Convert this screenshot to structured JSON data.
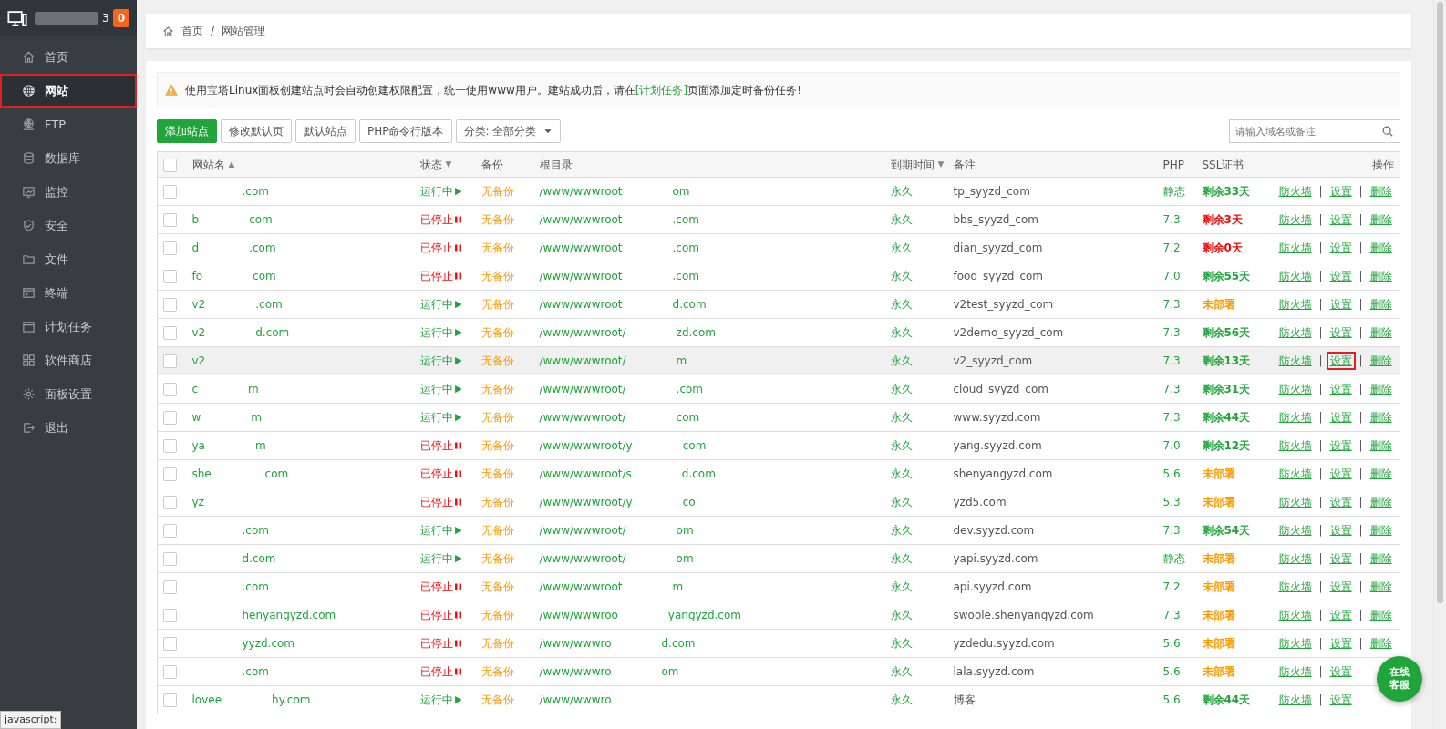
{
  "sidebar": {
    "title_end": "3",
    "badge": "0",
    "items": [
      {
        "label": "首页",
        "selected": false,
        "boxed": false
      },
      {
        "label": "网站",
        "selected": true,
        "boxed": true
      },
      {
        "label": "FTP",
        "selected": false,
        "boxed": false
      },
      {
        "label": "数据库",
        "selected": false,
        "boxed": false
      },
      {
        "label": "监控",
        "selected": false,
        "boxed": false
      },
      {
        "label": "安全",
        "selected": false,
        "boxed": false
      },
      {
        "label": "文件",
        "selected": false,
        "boxed": false
      },
      {
        "label": "终端",
        "selected": false,
        "boxed": false
      },
      {
        "label": "计划任务",
        "selected": false,
        "boxed": false
      },
      {
        "label": "软件商店",
        "selected": false,
        "boxed": false
      },
      {
        "label": "面板设置",
        "selected": false,
        "boxed": false
      },
      {
        "label": "退出",
        "selected": false,
        "boxed": false
      }
    ]
  },
  "breadcrumb": [
    "首页",
    "网站管理"
  ],
  "breadcrumb_separator": "/",
  "alert": {
    "before": "使用宝塔Linux面板创建站点时会自动创建权限配置，统一使用www用户。建站成功后，请在",
    "link": "[计划任务]",
    "after": "页面添加定时备份任务!"
  },
  "toolbar": {
    "primary": "添加站点",
    "buttons": [
      "修改默认页",
      "默认站点",
      "PHP命令行版本"
    ],
    "category": "分类: 全部分类",
    "search": {
      "placeholder": "请输入域名或备注"
    }
  },
  "table": {
    "header_checked": false,
    "action_separator": "|",
    "columns": [
      {
        "label": "网站名",
        "sort_icon": "▲"
      },
      {
        "label": "状态",
        "sort_icon": "▼"
      },
      {
        "label": "备份"
      },
      {
        "label": "根目录"
      },
      {
        "label": "到期时间",
        "sort_icon": "▼"
      },
      {
        "label": "备注"
      },
      {
        "label": "PHP"
      },
      {
        "label": "SSL证书"
      },
      {
        "label": "操作"
      }
    ],
    "rows": [
      {
        "checked": false,
        "highlighted": false,
        "name_start": "",
        "name_end": ".com",
        "running": true,
        "status_text": "运行中",
        "backup": "无备份",
        "path_start": "/www/wwwroot",
        "path_end": "om",
        "expiry": "永久",
        "remark": "tp_syyzd_com",
        "php": "静态",
        "ssl": "剩余33天",
        "color": "#20a53a",
        "actions": [
          "防火墙",
          "设置",
          "删除"
        ],
        "boxed_action": false
      },
      {
        "checked": false,
        "highlighted": false,
        "name_start": "b",
        "name_end": "com",
        "running": false,
        "status_text": "已停止",
        "backup": "无备份",
        "path_start": "/www/wwwroot",
        "path_end": ".com",
        "expiry": "永久",
        "remark": "bbs_syyzd_com",
        "php": "7.3",
        "ssl": "剩余3天",
        "color": "#ef0808",
        "actions": [
          "防火墙",
          "设置",
          "删除"
        ],
        "boxed_action": false
      },
      {
        "checked": false,
        "highlighted": false,
        "name_start": "d",
        "name_end": ".com",
        "running": false,
        "status_text": "已停止",
        "backup": "无备份",
        "path_start": "/www/wwwroot",
        "path_end": ".com",
        "expiry": "永久",
        "remark": "dian_syyzd_com",
        "php": "7.2",
        "ssl": "剩余0天",
        "color": "#ef0808",
        "actions": [
          "防火墙",
          "设置",
          "删除"
        ],
        "boxed_action": false
      },
      {
        "checked": false,
        "highlighted": false,
        "name_start": "fo",
        "name_end": "com",
        "running": false,
        "status_text": "已停止",
        "backup": "无备份",
        "path_start": "/www/wwwroot",
        "path_end": ".com",
        "expiry": "永久",
        "remark": "food_syyzd_com",
        "php": "7.0",
        "ssl": "剩余55天",
        "color": "#20a53a",
        "actions": [
          "防火墙",
          "设置",
          "删除"
        ],
        "boxed_action": false
      },
      {
        "checked": false,
        "highlighted": false,
        "name_start": "v2",
        "name_end": ".com",
        "running": true,
        "status_text": "运行中",
        "backup": "无备份",
        "path_start": "/www/wwwroot",
        "path_end": "d.com",
        "expiry": "永久",
        "remark": "v2test_syyzd_com",
        "php": "7.3",
        "ssl": "未部署",
        "color": "#ff9900",
        "actions": [
          "防火墙",
          "设置",
          "删除"
        ],
        "boxed_action": false
      },
      {
        "checked": false,
        "highlighted": false,
        "name_start": "v2",
        "name_end": "d.com",
        "running": true,
        "status_text": "运行中",
        "backup": "无备份",
        "path_start": "/www/wwwroot/",
        "path_end": "zd.com",
        "expiry": "永久",
        "remark": "v2demo_syyzd_com",
        "php": "7.3",
        "ssl": "剩余56天",
        "color": "#20a53a",
        "actions": [
          "防火墙",
          "设置",
          "删除"
        ],
        "boxed_action": false
      },
      {
        "checked": false,
        "highlighted": true,
        "name_start": "v2",
        "name_end": "",
        "running": true,
        "status_text": "运行中",
        "backup": "无备份",
        "path_start": "/www/wwwroot/",
        "path_end": "m",
        "expiry": "永久",
        "remark": "v2_syyzd_com",
        "php": "7.3",
        "ssl": "剩余13天",
        "color": "#20a53a",
        "actions": [
          "防火墙",
          "设置",
          "删除"
        ],
        "boxed_action": true
      },
      {
        "checked": false,
        "highlighted": false,
        "name_start": "c",
        "name_end": "m",
        "running": true,
        "status_text": "运行中",
        "backup": "无备份",
        "path_start": "/www/wwwroot/",
        "path_end": ".com",
        "expiry": "永久",
        "remark": "cloud_syyzd_com",
        "php": "7.3",
        "ssl": "剩余31天",
        "color": "#20a53a",
        "actions": [
          "防火墙",
          "设置",
          "删除"
        ],
        "boxed_action": false
      },
      {
        "checked": false,
        "highlighted": false,
        "name_start": "w",
        "name_end": "m",
        "running": true,
        "status_text": "运行中",
        "backup": "无备份",
        "path_start": "/www/wwwroot/",
        "path_end": "com",
        "expiry": "永久",
        "remark": "www.syyzd.com",
        "php": "7.3",
        "ssl": "剩余44天",
        "color": "#20a53a",
        "actions": [
          "防火墙",
          "设置",
          "删除"
        ],
        "boxed_action": false
      },
      {
        "checked": false,
        "highlighted": false,
        "name_start": "ya",
        "name_end": "m",
        "running": false,
        "status_text": "已停止",
        "backup": "无备份",
        "path_start": "/www/wwwroot/y",
        "path_end": "com",
        "expiry": "永久",
        "remark": "yang.syyzd.com",
        "php": "7.0",
        "ssl": "剩余12天",
        "color": "#20a53a",
        "actions": [
          "防火墙",
          "设置",
          "删除"
        ],
        "boxed_action": false
      },
      {
        "checked": false,
        "highlighted": false,
        "name_start": "she",
        "name_end": ".com",
        "running": false,
        "status_text": "已停止",
        "backup": "无备份",
        "path_start": "/www/wwwroot/s",
        "path_end": "d.com",
        "expiry": "永久",
        "remark": "shenyangyzd.com",
        "php": "5.6",
        "ssl": "未部署",
        "color": "#ff9900",
        "actions": [
          "防火墙",
          "设置",
          "删除"
        ],
        "boxed_action": false
      },
      {
        "checked": false,
        "highlighted": false,
        "name_start": "yz",
        "name_end": "",
        "running": false,
        "status_text": "已停止",
        "backup": "无备份",
        "path_start": "/www/wwwroot/y",
        "path_end": "co",
        "expiry": "永久",
        "remark": "yzd5.com",
        "php": "5.3",
        "ssl": "未部署",
        "color": "#ff9900",
        "actions": [
          "防火墙",
          "设置",
          "删除"
        ],
        "boxed_action": false
      },
      {
        "checked": false,
        "highlighted": false,
        "name_start": "",
        "name_end": ".com",
        "running": true,
        "status_text": "运行中",
        "backup": "无备份",
        "path_start": "/www/wwwroot/",
        "path_end": "om",
        "expiry": "永久",
        "remark": "dev.syyzd.com",
        "php": "7.3",
        "ssl": "剩余54天",
        "color": "#20a53a",
        "actions": [
          "防火墙",
          "设置",
          "删除"
        ],
        "boxed_action": false
      },
      {
        "checked": false,
        "highlighted": false,
        "name_start": "",
        "name_end": "d.com",
        "running": true,
        "status_text": "运行中",
        "backup": "无备份",
        "path_start": "/www/wwwroot/",
        "path_end": "om",
        "expiry": "永久",
        "remark": "yapi.syyzd.com",
        "php": "静态",
        "ssl": "未部署",
        "color": "#ff9900",
        "actions": [
          "防火墙",
          "设置",
          "删除"
        ],
        "boxed_action": false
      },
      {
        "checked": false,
        "highlighted": false,
        "name_start": "",
        "name_end": ".com",
        "running": false,
        "status_text": "已停止",
        "backup": "无备份",
        "path_start": "/www/wwwroot",
        "path_end": "m",
        "expiry": "永久",
        "remark": "api.syyzd.com",
        "php": "7.2",
        "ssl": "未部署",
        "color": "#ff9900",
        "actions": [
          "防火墙",
          "设置",
          "删除"
        ],
        "boxed_action": false
      },
      {
        "checked": false,
        "highlighted": false,
        "name_start": "",
        "name_end": "henyangyzd.com",
        "running": false,
        "status_text": "已停止",
        "backup": "无备份",
        "path_start": "/www/wwwroo",
        "path_end": "yangyzd.com",
        "expiry": "永久",
        "remark": "swoole.shenyangyzd.com",
        "php": "7.3",
        "ssl": "未部署",
        "color": "#ff9900",
        "actions": [
          "防火墙",
          "设置",
          "删除"
        ],
        "boxed_action": false
      },
      {
        "checked": false,
        "highlighted": false,
        "name_start": "",
        "name_end": "yyzd.com",
        "running": false,
        "status_text": "已停止",
        "backup": "无备份",
        "path_start": "/www/wwwro",
        "path_end": "d.com",
        "expiry": "永久",
        "remark": "yzdedu.syyzd.com",
        "php": "5.6",
        "ssl": "未部署",
        "color": "#ff9900",
        "actions": [
          "防火墙",
          "设置",
          "删除"
        ],
        "boxed_action": false
      },
      {
        "checked": false,
        "highlighted": false,
        "name_start": "",
        "name_end": ".com",
        "running": false,
        "status_text": "已停止",
        "backup": "无备份",
        "path_start": "/www/wwwro",
        "path_end": "om",
        "expiry": "永久",
        "remark": "lala.syyzd.com",
        "php": "5.6",
        "ssl": "未部署",
        "color": "#ff9900",
        "actions": [
          "防火墙",
          "设置"
        ],
        "boxed_action": false
      },
      {
        "checked": false,
        "highlighted": false,
        "name_start": "lovee",
        "name_end": "hy.com",
        "running": true,
        "status_text": "运行中",
        "backup": "无备份",
        "path_start": "/www/wwwro",
        "path_end": "",
        "expiry": "永久",
        "remark": "博客",
        "php": "5.6",
        "ssl": "剩余44天",
        "color": "#20a53a",
        "actions": [
          "防火墙",
          "设置"
        ],
        "boxed_action": false
      }
    ]
  },
  "chat_button": "在线客服",
  "status_tooltip": "javascript:"
}
